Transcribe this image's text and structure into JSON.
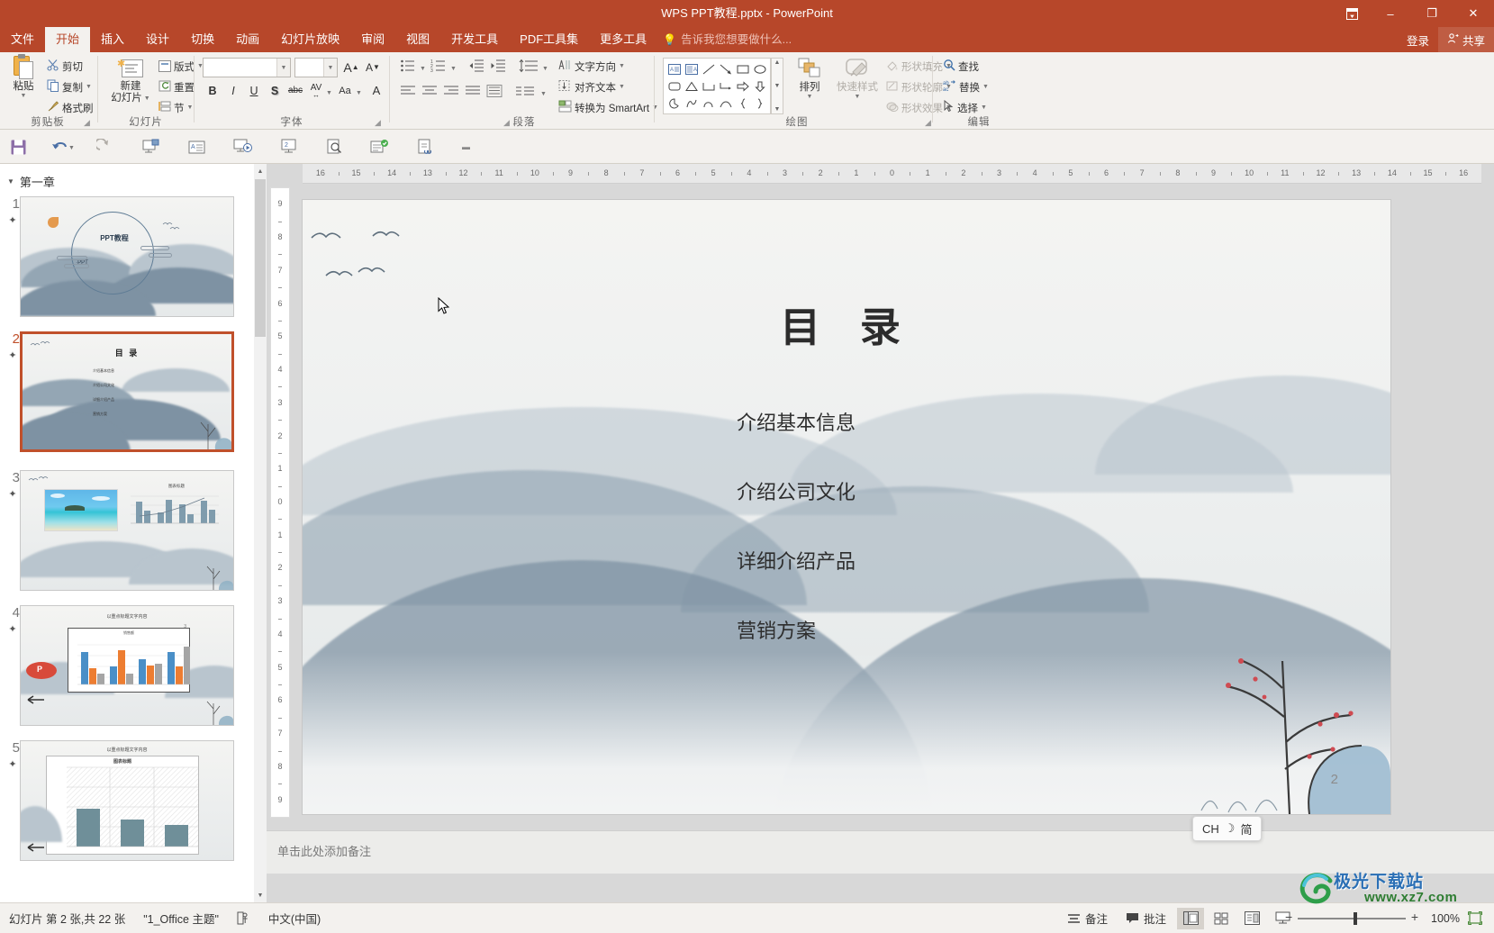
{
  "window": {
    "title": "WPS PPT教程.pptx - PowerPoint",
    "ribbon_display_icon": "ribbon-display-options-icon",
    "minimize": "–",
    "maximize": "❐",
    "close": "✕"
  },
  "tabs": [
    {
      "label": "文件",
      "active": false
    },
    {
      "label": "开始",
      "active": true
    },
    {
      "label": "插入",
      "active": false
    },
    {
      "label": "设计",
      "active": false
    },
    {
      "label": "切换",
      "active": false
    },
    {
      "label": "动画",
      "active": false
    },
    {
      "label": "幻灯片放映",
      "active": false
    },
    {
      "label": "审阅",
      "active": false
    },
    {
      "label": "视图",
      "active": false
    },
    {
      "label": "开发工具",
      "active": false
    },
    {
      "label": "PDF工具集",
      "active": false
    },
    {
      "label": "更多工具",
      "active": false
    }
  ],
  "tellme": {
    "placeholder": "告诉我您想要做什么...",
    "icon": "lightbulb-icon"
  },
  "account": {
    "signin": "登录",
    "share": "共享",
    "share_icon": "share-person-icon"
  },
  "ribbon": {
    "groups": [
      {
        "name": "剪贴板"
      },
      {
        "name": "幻灯片"
      },
      {
        "name": "字体"
      },
      {
        "name": "段落"
      },
      {
        "name": "绘图"
      },
      {
        "name": "编辑"
      }
    ],
    "clipboard": {
      "paste": "粘贴",
      "cut": "剪切",
      "copy": "复制",
      "format_painter": "格式刷"
    },
    "slides": {
      "new_slide": "新建\n幻灯片",
      "new_slide_l1": "新建",
      "new_slide_l2": "幻灯片",
      "layout": "版式",
      "reset": "重置",
      "section": "节"
    },
    "font": {
      "font_name": "",
      "font_size": "",
      "grow": "A",
      "shrink": "A",
      "bold": "B",
      "italic": "I",
      "underline": "U",
      "shadow": "S",
      "strike": "abc",
      "spacing": "AV",
      "case": "Aa",
      "color": "A"
    },
    "paragraph": {
      "text_direction": "文字方向",
      "align_text": "对齐文本",
      "smartart": "转换为 SmartArt"
    },
    "drawing": {
      "arrange": "排列",
      "quick_styles": "快速样式",
      "shape_fill": "形状填充",
      "shape_outline": "形状轮廓",
      "shape_effects": "形状效果"
    },
    "editing": {
      "find": "查找",
      "replace": "替换",
      "select": "选择"
    }
  },
  "quick_access": [
    {
      "name": "save-icon"
    },
    {
      "name": "undo-icon"
    },
    {
      "name": "redo-icon"
    },
    {
      "name": "start-from-current-icon"
    },
    {
      "name": "text-box-icon"
    },
    {
      "name": "slideshow-icon"
    },
    {
      "name": "presenter-view-icon"
    },
    {
      "name": "print-preview-icon"
    },
    {
      "name": "spell-check-icon"
    },
    {
      "name": "hyperlink-icon"
    }
  ],
  "thumbnails": {
    "section_title": "第一章",
    "slides": [
      {
        "num": "1",
        "selected": false,
        "title": "PPT教程",
        "subtitle": "·PPT"
      },
      {
        "num": "2",
        "selected": true,
        "title": "目 录"
      },
      {
        "num": "3",
        "selected": false,
        "chart_title": "图表标题"
      },
      {
        "num": "4",
        "selected": false,
        "heading": "以重点标题文字内容",
        "chart_title": "销售额",
        "page": "3"
      },
      {
        "num": "5",
        "selected": false,
        "heading": "以重点标题文字内容",
        "chart_title": "图表标题"
      }
    ]
  },
  "slide": {
    "title": "目 录",
    "toc": [
      {
        "label": "介绍基本信息"
      },
      {
        "label": "介绍公司文化"
      },
      {
        "label": "详细介绍产品"
      },
      {
        "label": "营销方案"
      }
    ],
    "page_number": "2"
  },
  "rulers": {
    "horizontal": [
      "16",
      "15",
      "14",
      "13",
      "12",
      "11",
      "10",
      "9",
      "8",
      "7",
      "6",
      "5",
      "4",
      "3",
      "2",
      "1",
      "0",
      "1",
      "2",
      "3",
      "4",
      "5",
      "6",
      "7",
      "8",
      "9",
      "10",
      "11",
      "12",
      "13",
      "14",
      "15",
      "16"
    ],
    "vertical": [
      "9",
      "8",
      "7",
      "6",
      "5",
      "4",
      "3",
      "2",
      "1",
      "0",
      "1",
      "2",
      "3",
      "4",
      "5",
      "6",
      "7",
      "8",
      "9"
    ]
  },
  "notes": {
    "placeholder": "单击此处添加备注"
  },
  "ime": {
    "lang": "CH",
    "moon": "☽",
    "mode": "简"
  },
  "statusbar": {
    "slide_info": "幻灯片 第 2 张,共 22 张",
    "theme": "\"1_Office 主题\"",
    "accessibility_icon": "accessibility-icon",
    "language": "中文(中国)",
    "notes_btn": "备注",
    "comments_btn": "批注",
    "views": [
      {
        "name": "normal-view-icon",
        "active": true
      },
      {
        "name": "slide-sorter-icon",
        "active": false
      },
      {
        "name": "reading-view-icon",
        "active": false
      },
      {
        "name": "slideshow-view-icon",
        "active": false
      }
    ],
    "zoom_out": "−",
    "zoom_in": "+",
    "zoom_level": "100%",
    "fit_slide_icon": "fit-to-window-icon"
  },
  "watermark": {
    "text": "极光下载站",
    "url": "www.xz7.com"
  },
  "colors": {
    "accent": "#b7472a",
    "selection": "#c0502b",
    "ribbon_bg": "#f3f1ee",
    "editor_bg": "#d8d8d8"
  }
}
